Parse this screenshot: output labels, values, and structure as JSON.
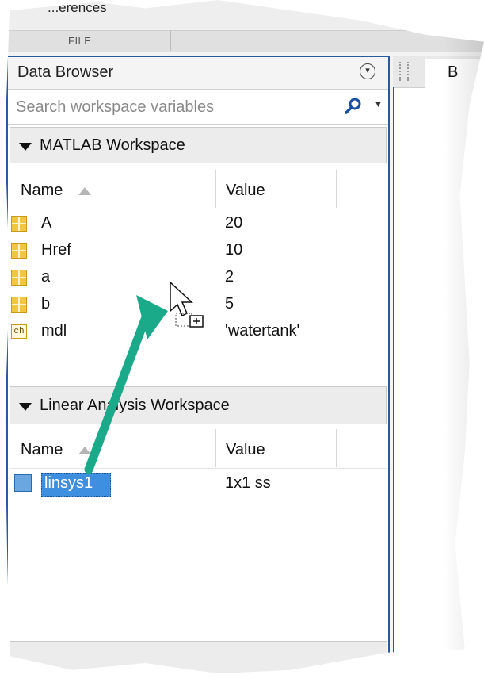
{
  "ribbon": {
    "top_text": "...erences",
    "file_tab": "FILE"
  },
  "data_browser": {
    "title": "Data Browser",
    "menu_icon": "circle-chevron-down-icon",
    "search_placeholder": "Search workspace variables",
    "search_icon": "search-icon"
  },
  "matlab_workspace": {
    "title": "MATLAB Workspace",
    "columns": {
      "name": "Name",
      "value": "Value"
    },
    "rows": [
      {
        "name": "A",
        "value": "20",
        "icon": "matrix-icon"
      },
      {
        "name": "Href",
        "value": "10",
        "icon": "matrix-icon"
      },
      {
        "name": "a",
        "value": "2",
        "icon": "matrix-icon"
      },
      {
        "name": "b",
        "value": "5",
        "icon": "matrix-icon"
      },
      {
        "name": "mdl",
        "value": "'watertank'",
        "icon": "char-icon",
        "icon_text": "ch"
      }
    ]
  },
  "linear_workspace": {
    "title": "Linear Analysis Workspace",
    "columns": {
      "name": "Name",
      "value": "Value"
    },
    "rows": [
      {
        "name": "linsys1",
        "value": "1x1 ss",
        "icon": "ss-model-icon",
        "selected": true
      }
    ]
  },
  "right_tab": {
    "label": "B"
  },
  "annotation": {
    "arrow_color": "#1aaa8a",
    "cursor": "drag-copy-cursor"
  },
  "colors": {
    "panel_border": "#2a5a9e",
    "selection": "#3f8fe0",
    "variable_icon": "#f5c542"
  }
}
